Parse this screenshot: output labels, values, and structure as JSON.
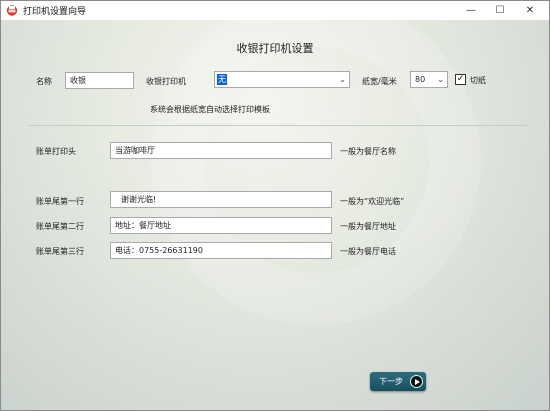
{
  "window": {
    "title": "打印机设置向导",
    "minimize_glyph": "—",
    "maximize_glyph": "☐",
    "close_glyph": "✕"
  },
  "heading": "收银打印机设置",
  "printer_row": {
    "name_label": "名称",
    "name_value": "收银",
    "printer_label": "收银打印机",
    "printer_value": "无",
    "paper_width_label": "纸宽/毫米",
    "paper_width_value": "80",
    "cut_paper_label": "切纸",
    "cut_paper_checked": true,
    "cut_paper_mark": "✓"
  },
  "template_hint": "系统会根据纸宽自动选择打印模板",
  "receipt_header": {
    "label": "账单打印头",
    "value": "当游咖啡厅",
    "hint": "一般为餐厅名称"
  },
  "footer_lines": [
    {
      "label": "账单尾第一行",
      "value": "谢谢光临!",
      "hint": "一般为“欢迎光临”"
    },
    {
      "label": "账单尾第二行",
      "value": "地址：餐厅地址",
      "hint": "一般为餐厅地址"
    },
    {
      "label": "账单尾第三行",
      "value": "电话：0755-26631190",
      "hint": "一般为餐厅电话"
    }
  ],
  "next_button": {
    "label": "下一步"
  },
  "icons": {
    "app": "printer-app-icon",
    "dropdown": "chevron-down-icon",
    "next": "play-circle-icon"
  },
  "colors": {
    "selection_highlight": "#0a64d8",
    "next_button": "#1f5a6b"
  }
}
